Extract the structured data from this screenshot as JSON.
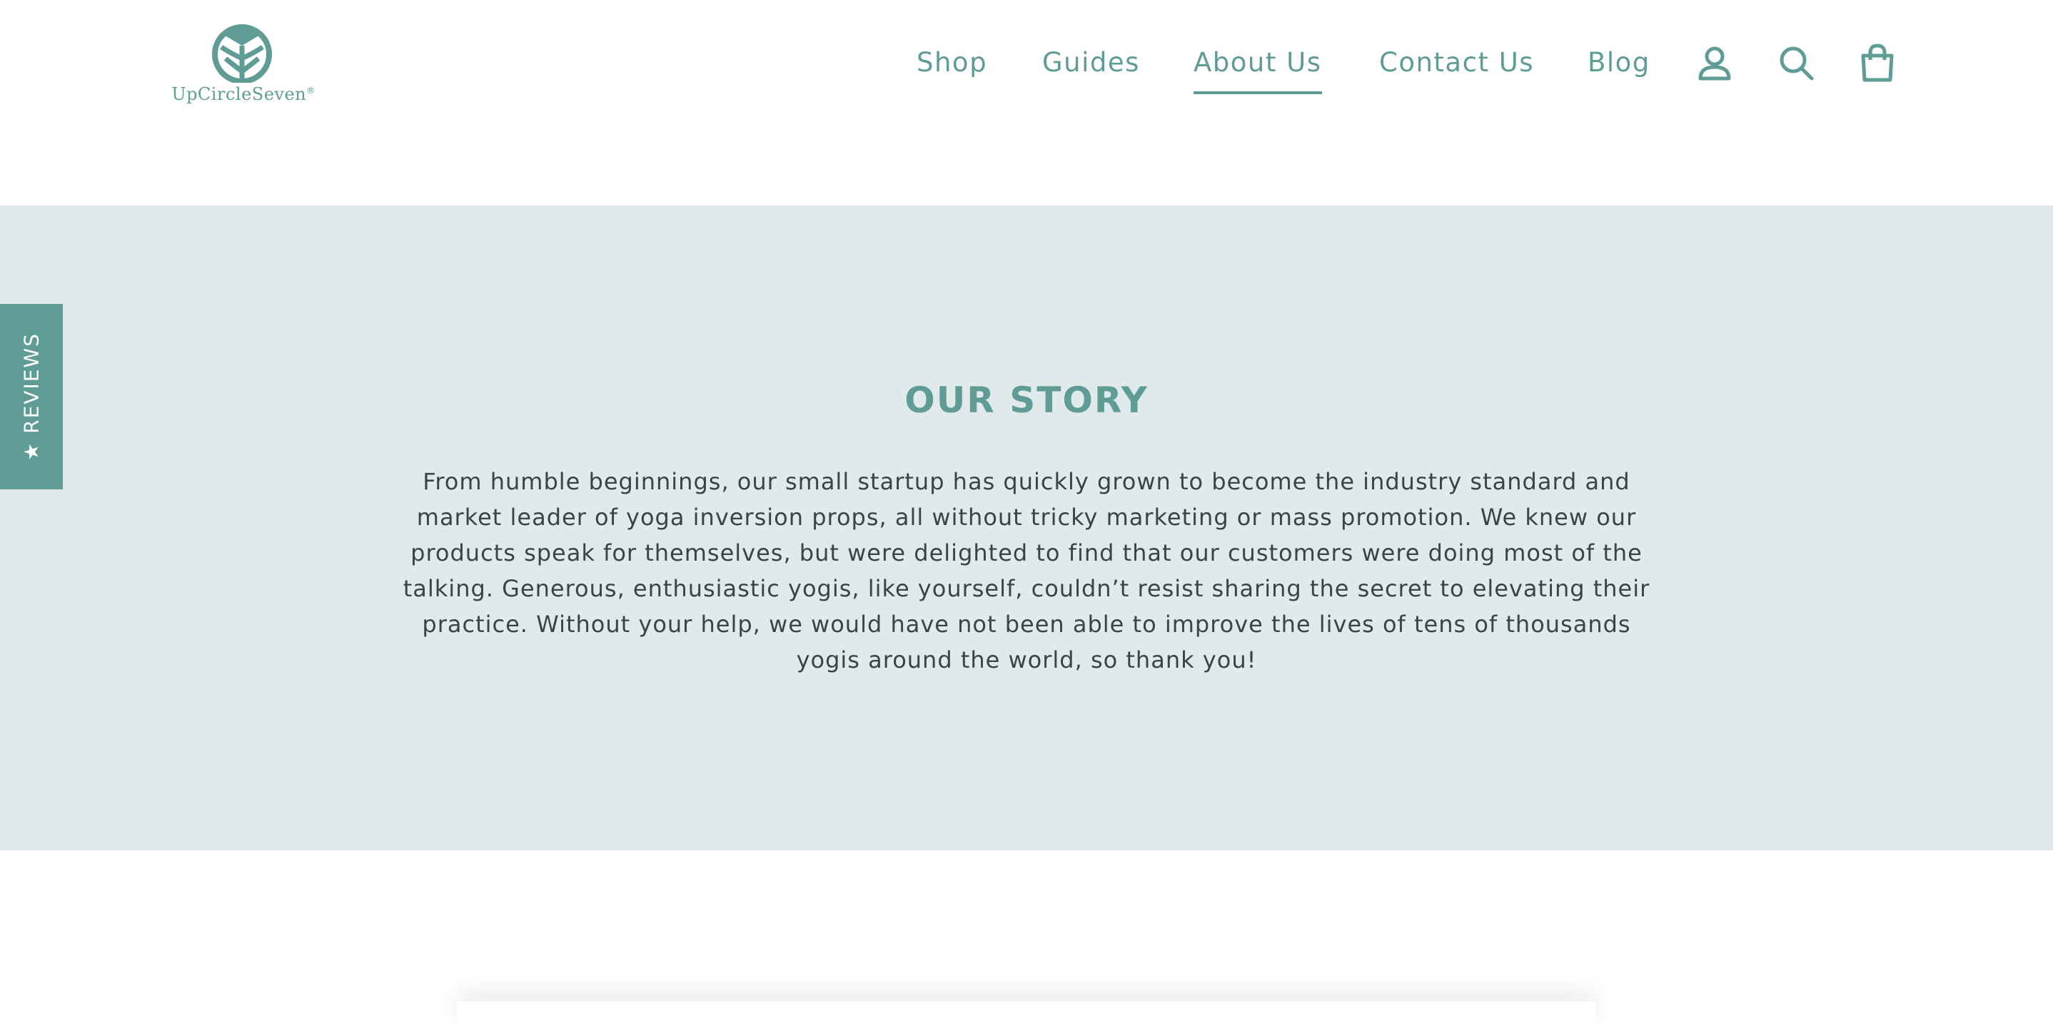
{
  "brand": {
    "name": "UpCircleSeven",
    "registered_mark": "®",
    "color": "#5e9c95"
  },
  "nav": {
    "items": [
      {
        "label": "Shop",
        "active": false
      },
      {
        "label": "Guides",
        "active": false
      },
      {
        "label": "About Us",
        "active": true
      },
      {
        "label": "Contact Us",
        "active": false
      },
      {
        "label": "Blog",
        "active": false
      }
    ],
    "icons": [
      "account-icon",
      "search-icon",
      "cart-icon"
    ]
  },
  "reviews_tab": {
    "label": "REVIEWS",
    "icon": "star-icon",
    "star": "★"
  },
  "story": {
    "title": "OUR STORY",
    "text": "From humble beginnings, our small startup has quickly grown to become the industry standard and market leader of yoga inversion props, all without tricky marketing or mass promotion. We knew our products speak for themselves, but were delighted to find that our customers were doing most of the talking. Generous, enthusiastic yogis, like yourself, couldn’t resist sharing the secret to elevating their practice. Without your help, we would have not been able to improve the lives of tens of thousands yogis around the world, so thank you!",
    "background": "#e1eaeb",
    "text_color": "#3c4343"
  }
}
